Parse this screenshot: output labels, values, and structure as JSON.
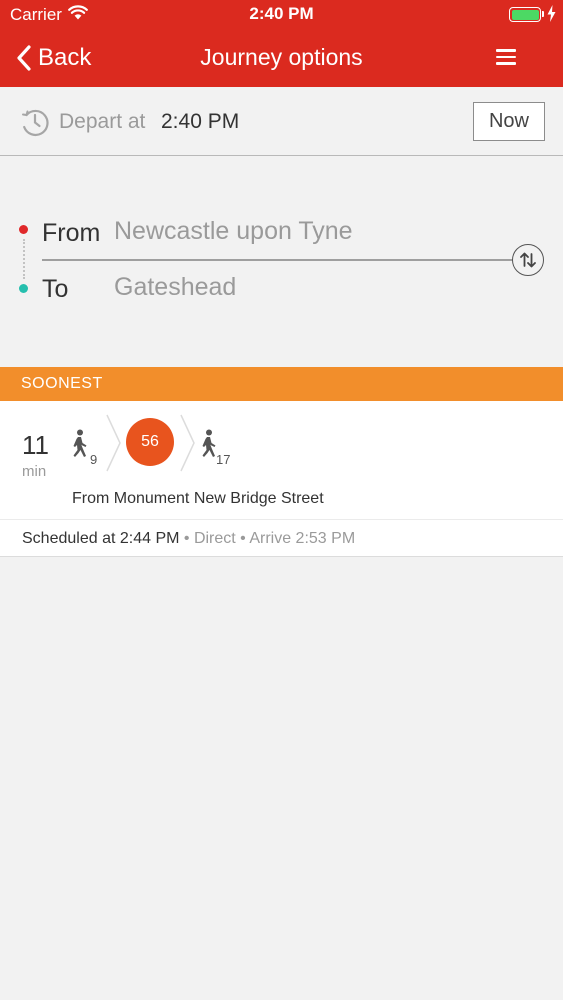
{
  "status_bar": {
    "carrier": "Carrier",
    "time": "2:40 PM",
    "battery_level": 1.0,
    "wifi_icon": "wifi-icon",
    "charging_icon": "bolt-icon"
  },
  "nav": {
    "back_label": "Back",
    "title": "Journey options",
    "menu_icon": "hamburger-menu-icon"
  },
  "depart": {
    "label": "Depart at",
    "time": "2:40 PM",
    "now_label": "Now",
    "clock_icon": "clock-icon"
  },
  "route": {
    "from_label": "From",
    "from_value": "Newcastle upon Tyne",
    "to_label": "To",
    "to_value": "Gateshead",
    "swap_icon": "swap-arrows-icon"
  },
  "section": {
    "title": "SOONEST"
  },
  "journey": {
    "duration": "11",
    "unit": "min",
    "walk_before": "9",
    "bus_number": "56",
    "walk_after": "17",
    "from_stop": "From Monument New Bridge Street",
    "scheduled": "Scheduled at 2:44 PM",
    "type": "Direct",
    "arrive": "Arrive 2:53 PM",
    "separator": " • "
  },
  "colors": {
    "header": "#db2a1f",
    "section": "#f28e2b",
    "bus": "#e8541e",
    "from_dot": "#e0282a",
    "to_dot": "#26bfae",
    "battery": "#4cd964"
  }
}
